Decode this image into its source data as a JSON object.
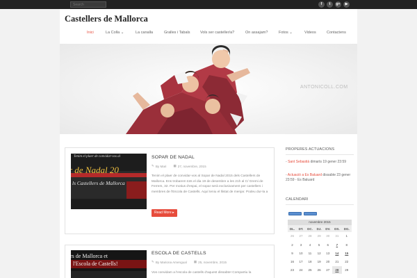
{
  "search": {
    "placeholder": "Search"
  },
  "social": [
    {
      "name": "facebook",
      "glyph": "f"
    },
    {
      "name": "twitter",
      "glyph": "t"
    },
    {
      "name": "google-plus",
      "glyph": "g+"
    },
    {
      "name": "youtube",
      "glyph": "▶"
    }
  ],
  "site": {
    "title": "Castellers de Mallorca"
  },
  "nav": [
    {
      "label": "Inici",
      "active": true
    },
    {
      "label": "La Colla",
      "dropdown": true
    },
    {
      "label": "La canalla"
    },
    {
      "label": "Gralles i Tabals"
    },
    {
      "label": "Vols ser casteller/a?"
    },
    {
      "label": "On assajam?"
    },
    {
      "label": "Fotos",
      "dropdown": true
    },
    {
      "label": "Videos"
    },
    {
      "label": "Contactens"
    }
  ],
  "hero": {
    "watermark": "ANTONICOLL.COM"
  },
  "posts": [
    {
      "title": "SOPAR DE NADAL",
      "author": "By Mari",
      "date": "27, novembre, 2015",
      "excerpt": "Tenim el plaer de convidar-vos al Sopar de Nadal 2015 dels Castellers de Mallorca. Ens trobarem tots el dia 19 de desembre a les 21h al C/ Gremi de Ferrers, 32. Per motius d'espai, el sopar serà exclusivament per castellers i membres de l'Escola de Castells. Aquí teniu el llistat de menjar. Podeu dur-la a",
      "read_more": "Read More ▸",
      "thumb_text": "r de Nadal 20",
      "thumb_text2": "ls Castellers de Mallorca",
      "thumb_text3": "Tenim el plaer de convidar-vos al"
    },
    {
      "title": "ESCOLA DE CASTELLS",
      "author": "By Mariona Amengual",
      "date": "25, novembre, 2015",
      "excerpt": "Vos convidam a l'escola de castells d'aquest dissabte! Compartiu la",
      "thumb_text": "rs de Mallorca et",
      "thumb_text2": "l'Escola de Castells!"
    }
  ],
  "sidebar": {
    "upcoming_title": "PROPERES ACTUACIONS",
    "events": [
      {
        "name": "Sant Sebastià",
        "when": "dimarts 19 gener 23:59"
      },
      {
        "name": "Actuació a Es Baluard",
        "when": "dissabte 23 gener 23:59",
        "place": "Es Baluard"
      }
    ],
    "calendar_title": "CALENDARI",
    "calendar": {
      "month": "novembre 2015",
      "weekdays": [
        "DL.",
        "DT.",
        "DC.",
        "DJ.",
        "DV.",
        "DS.",
        "DG."
      ],
      "rows": [
        [
          "26",
          "27",
          "28",
          "29",
          "30",
          "31",
          "1"
        ],
        [
          "2",
          "3",
          "4",
          "5",
          "6",
          "7",
          "8"
        ],
        [
          "9",
          "10",
          "11",
          "12",
          "13",
          "14",
          "15"
        ],
        [
          "16",
          "17",
          "18",
          "19",
          "20",
          "21",
          "22"
        ],
        [
          "23",
          "24",
          "25",
          "26",
          "27",
          "28",
          "29"
        ]
      ]
    }
  },
  "colors": {
    "accent": "#e74c3c",
    "topbar": "#222222",
    "background": "#f2f2f2"
  }
}
